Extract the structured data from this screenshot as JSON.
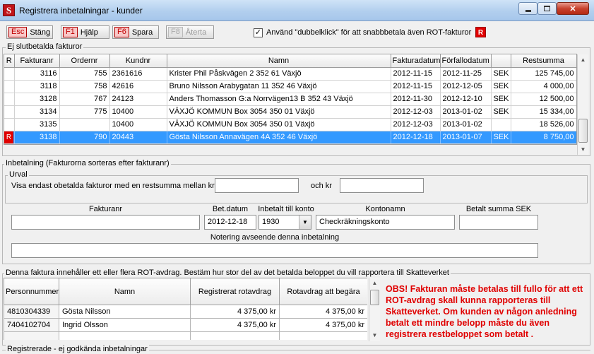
{
  "window": {
    "title": "Registrera inbetalningar - kunder",
    "app_icon": "S"
  },
  "toolbar": {
    "buttons": [
      {
        "key": "Esc",
        "label": "Stäng"
      },
      {
        "key": "F1",
        "label": "Hjälp"
      },
      {
        "key": "F6",
        "label": "Spara"
      },
      {
        "key": "F8",
        "label": "Återta"
      }
    ],
    "checkbox_label": "Använd \"dubbelklick\" för att snabbbetala även ROT-fakturor",
    "checkbox_checked": "✓",
    "rot_badge": "R"
  },
  "unpaid": {
    "group_label": "Ej slutbetalda fakturor",
    "columns": [
      "R",
      "Fakturanr",
      "Ordernr",
      "Kundnr",
      "Namn",
      "Fakturadatum",
      "Förfallodatum",
      "",
      "Restsumma"
    ],
    "rows": [
      {
        "r": "",
        "fakturanr": "3116",
        "ordernr": "755",
        "kundnr": "2361616",
        "namn": "Krister Phil  Påskvägen 2 352 61 Växjö",
        "fakturadatum": "2012-11-15",
        "forfallodatum": "2012-11-25",
        "valuta": "SEK",
        "restsumma": "125 745,00"
      },
      {
        "r": "",
        "fakturanr": "3118",
        "ordernr": "758",
        "kundnr": "42616",
        "namn": "Bruno Nilsson  Arabygatan 11 352 46 Växjö",
        "fakturadatum": "2012-11-15",
        "forfallodatum": "2012-12-05",
        "valuta": "SEK",
        "restsumma": "4 000,00"
      },
      {
        "r": "",
        "fakturanr": "3128",
        "ordernr": "767",
        "kundnr": "24123",
        "namn": "Anders Thomasson  G:a Norrvägen13 B 352 43 Växjö",
        "fakturadatum": "2012-11-30",
        "forfallodatum": "2012-12-10",
        "valuta": "SEK",
        "restsumma": "12 500,00"
      },
      {
        "r": "",
        "fakturanr": "3134",
        "ordernr": "775",
        "kundnr": "10400",
        "namn": "VÄXJÖ KOMMUN  Box 3054 350 01 Växjö",
        "fakturadatum": "2012-12-03",
        "forfallodatum": "2013-01-02",
        "valuta": "SEK",
        "restsumma": "15 334,00"
      },
      {
        "r": "",
        "fakturanr": "3135",
        "ordernr": "",
        "kundnr": "10400",
        "namn": "VÄXJÖ KOMMUN  Box 3054 350 01 Växjö",
        "fakturadatum": "2012-12-03",
        "forfallodatum": "2013-01-02",
        "valuta": "",
        "restsumma": "18 526,00"
      },
      {
        "r": "R",
        "fakturanr": "3138",
        "ordernr": "790",
        "kundnr": "20443",
        "namn": "Gösta Nilsson  Annavägen 4A 352 46 Växjö",
        "fakturadatum": "2012-12-18",
        "forfallodatum": "2013-01-07",
        "valuta": "SEK",
        "restsumma": "8 750,00",
        "selected": true
      }
    ]
  },
  "payment": {
    "group_label": "Inbetalning (Fakturorna sorteras efter fakturanr)",
    "urval_label": "Urval",
    "filter_label": "Visa endast obetalda fakturor med en restsumma mellan kr",
    "and_label": "och kr",
    "filter_from": "",
    "filter_to": "",
    "labels": {
      "fakturanr": "Fakturanr",
      "bet_datum": "Bet.datum",
      "konto": "Inbetalt till konto",
      "kontonamn": "Kontonamn",
      "summa": "Betalt summa SEK",
      "notering": "Notering avseende denna inbetalning"
    },
    "values": {
      "fakturanr": "",
      "bet_datum": "2012-12-18",
      "konto": "1930",
      "kontonamn": "Checkräkningskonto",
      "summa": "",
      "notering": ""
    }
  },
  "rot": {
    "group_label": "Denna faktura innehåller ett eller flera ROT-avdrag. Bestäm hur stor del av det betalda beloppet du vill rapportera till Skatteverket",
    "columns": [
      "Personnummer",
      "Namn",
      "Registrerat rotavdrag",
      "Rotavdrag att begära"
    ],
    "rows": [
      {
        "personnummer": "4810304339",
        "namn": "Gösta Nilsson",
        "registrerat": "4 375,00 kr",
        "begara": "4 375,00 kr"
      },
      {
        "personnummer": "7404102704",
        "namn": "Ingrid Olsson",
        "registrerat": "4 375,00 kr",
        "begara": "4 375,00 kr"
      }
    ],
    "notice": "OBS! Fakturan måste betalas till fullo för att ett ROT-avdrag skall kunna rapporteras till Skatteverket. Om kunden av någon anledning betalt ett mindre belopp måste du även registrera restbeloppet som betalt ."
  },
  "registered": {
    "group_label": "Registrerade - ej godkända inbetalningar"
  },
  "colors": {
    "selection": "#3399ff",
    "alert": "#e00000",
    "fkey": "#c00000"
  }
}
